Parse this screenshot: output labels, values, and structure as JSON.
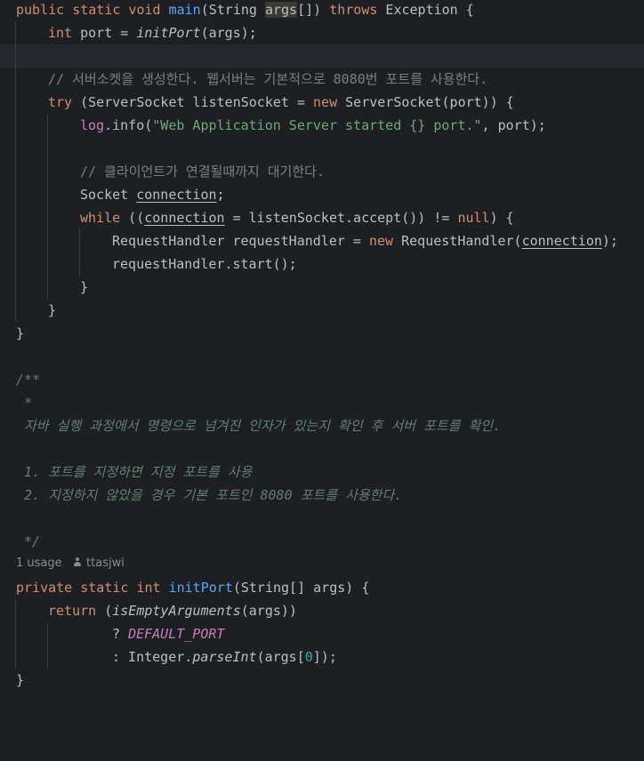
{
  "colors": {
    "background": "#1e1f22",
    "keyword": "#cf8e6d",
    "method": "#56a8f5",
    "string": "#6aab73",
    "comment": "#7a7e85",
    "doc_comment": "#5f826b",
    "constant": "#c77dbb",
    "number": "#2aacb8"
  },
  "inlay_hint": {
    "usage": "1 usage",
    "author": "ttasjwi",
    "author_icon": "person-icon"
  },
  "code": {
    "main_signature": {
      "kw": "public static void ",
      "name": "main",
      "open": "(String ",
      "args": "args",
      "mid": "[]) ",
      "throws": "throws",
      "end": " Exception {"
    },
    "port_line": {
      "kw": "int",
      "rest1": " port = ",
      "call": "initPort",
      "rest2": "(args);"
    },
    "comment_server": "// 서버소켓을 생성한다. 웹서버는 기본적으로 8080번 포트를 사용한다.",
    "try_line": {
      "kw_try": "try",
      "p1": " (ServerSocket listenSocket = ",
      "kw_new": "new",
      "p2": " ServerSocket(port)) {"
    },
    "log_line": {
      "log": "log",
      "p1": ".info(",
      "str": "\"Web Application Server started {} port.\"",
      "p2": ", port);"
    },
    "comment_client": "// 클라이언트가 연결될때까지 대기한다.",
    "socket_line": {
      "type": "Socket ",
      "var": "connection",
      "end": ";"
    },
    "while_line": {
      "kw_while": "while",
      "p1": " ((",
      "var": "connection",
      "p2": " = listenSocket.accept()) != ",
      "kw_null": "null",
      "p3": ") {"
    },
    "handler_line": {
      "p1": "RequestHandler requestHandler = ",
      "kw_new": "new",
      "p2": " RequestHandler(",
      "var": "connection",
      "p3": ");"
    },
    "start_line": "requestHandler.start();",
    "brace_open": "{",
    "brace_close": "}",
    "doc_open": "/**",
    "doc_star": " *",
    "doc_desc": " 자바 실행 과정에서 명령으로 넘겨진 인자가 있는지 확인 후 서버 포트를 확인.",
    "doc_item1": " 1. 포트를 지정하면 지정 포트를 사용",
    "doc_item2": " 2. 지정하지 않았을 경우 기본 포트인 8080 포트를 사용한다.",
    "doc_close": " */",
    "initport_signature": {
      "kw": "private static int ",
      "name": "initPort",
      "rest": "(String[] args) {"
    },
    "return_line": {
      "kw": "return",
      "p1": " (",
      "call": "isEmptyArguments",
      "p2": "(args))"
    },
    "ternary_line": {
      "q": "? ",
      "const": "DEFAULT_PORT"
    },
    "else_line": {
      "c": ": Integer.",
      "call": "parseInt",
      "p1": "(args[",
      "num": "0",
      "p2": "]);"
    }
  }
}
